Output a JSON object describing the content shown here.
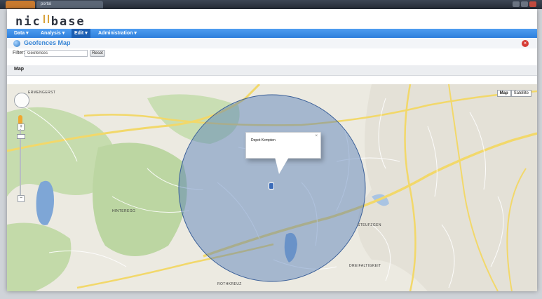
{
  "browser": {
    "tabs": [
      "portal"
    ]
  },
  "app": {
    "logo_left": "nic",
    "logo_right": "base",
    "menu": [
      {
        "label": "Data"
      },
      {
        "label": "Analysis"
      },
      {
        "label": "Edit"
      },
      {
        "label": "Administration"
      }
    ],
    "active_menu": "Edit",
    "page_title": "Geofences Map",
    "filter_label": "Filter:",
    "filter_value": "Geofences",
    "reset_label": "Reset",
    "section_label": "Map"
  },
  "map": {
    "type_buttons": [
      "Map",
      "Satellite"
    ],
    "active_type": "Map",
    "popup_title": "Depot Kempten",
    "popup_close": "×",
    "places": {
      "hintereggs": "HINTEREGG",
      "steufzgen": "STEUFZGEN",
      "rothkreuz": "ROTHKREUZ",
      "dreifaltigkeit": "DREIFALTIGKEIT",
      "ermengerst": "ERMENGERST"
    },
    "colors": {
      "geofence_fill": "#4f79b8",
      "geofence_stroke": "#3a5f98",
      "road_main": "#f2d86a",
      "road_minor": "#ffffff",
      "water": "#7ea6d6",
      "forest": "#b5d19a",
      "land": "#eceae1"
    }
  }
}
